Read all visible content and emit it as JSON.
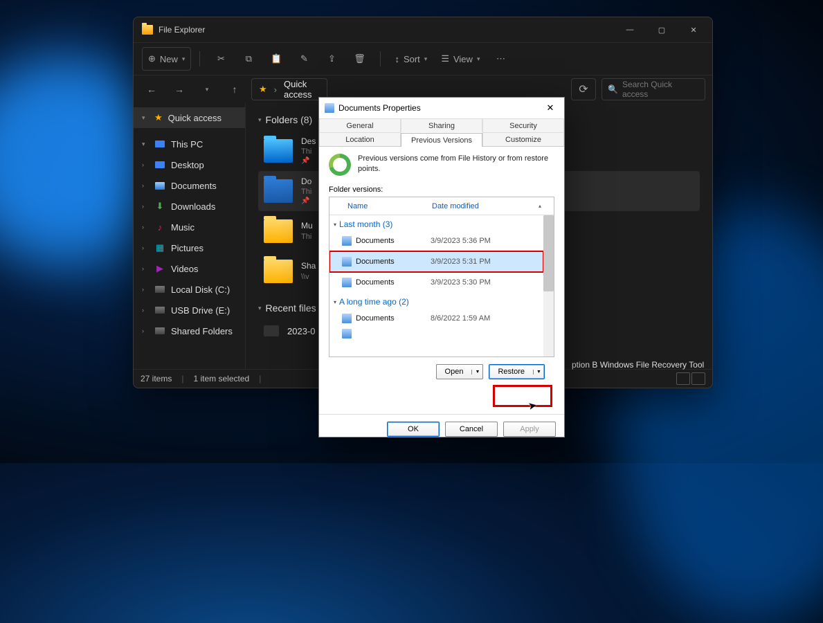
{
  "explorer": {
    "title": "File Explorer",
    "toolbar": {
      "new": "New",
      "sort": "Sort",
      "view": "View"
    },
    "address": {
      "label": "Quick access"
    },
    "search": {
      "placeholder": "Search Quick access"
    },
    "sidebar": {
      "quick": "Quick access",
      "thispc": "This PC",
      "items": [
        "Desktop",
        "Documents",
        "Downloads",
        "Music",
        "Pictures",
        "Videos",
        "Local Disk (C:)",
        "USB Drive (E:)",
        "Shared Folders"
      ]
    },
    "main": {
      "folders_header": "Folders (8)",
      "recent_header": "Recent files (",
      "items": [
        {
          "name": "Des",
          "sub": "Thi"
        },
        {
          "name": "Do",
          "sub": "Thi"
        },
        {
          "name": "Mu",
          "sub": "Thi"
        },
        {
          "name": "Sha",
          "sub": "\\\\v"
        }
      ],
      "recent_item": "2023-0"
    },
    "status": {
      "count": "27 items",
      "sel": "1 item selected"
    },
    "leaked_text": "ption B Windows File Recovery Tool"
  },
  "dialog": {
    "title": "Documents Properties",
    "tabs_row1": [
      "General",
      "Sharing",
      "Security"
    ],
    "tabs_row2": [
      "Location",
      "Previous Versions",
      "Customize"
    ],
    "info": "Previous versions come from File History or from restore points.",
    "fv_label": "Folder versions:",
    "columns": {
      "name": "Name",
      "date": "Date modified"
    },
    "groups": [
      {
        "label": "Last month (3)",
        "rows": [
          {
            "name": "Documents",
            "date": "3/9/2023 5:36 PM",
            "sel": false
          },
          {
            "name": "Documents",
            "date": "3/9/2023 5:31 PM",
            "sel": true
          },
          {
            "name": "Documents",
            "date": "3/9/2023 5:30 PM",
            "sel": false
          }
        ]
      },
      {
        "label": "A long time ago (2)",
        "rows": [
          {
            "name": "Documents",
            "date": "8/6/2022 1:59 AM",
            "sel": false
          }
        ]
      }
    ],
    "buttons": {
      "open": "Open",
      "restore": "Restore",
      "ok": "OK",
      "cancel": "Cancel",
      "apply": "Apply"
    }
  }
}
